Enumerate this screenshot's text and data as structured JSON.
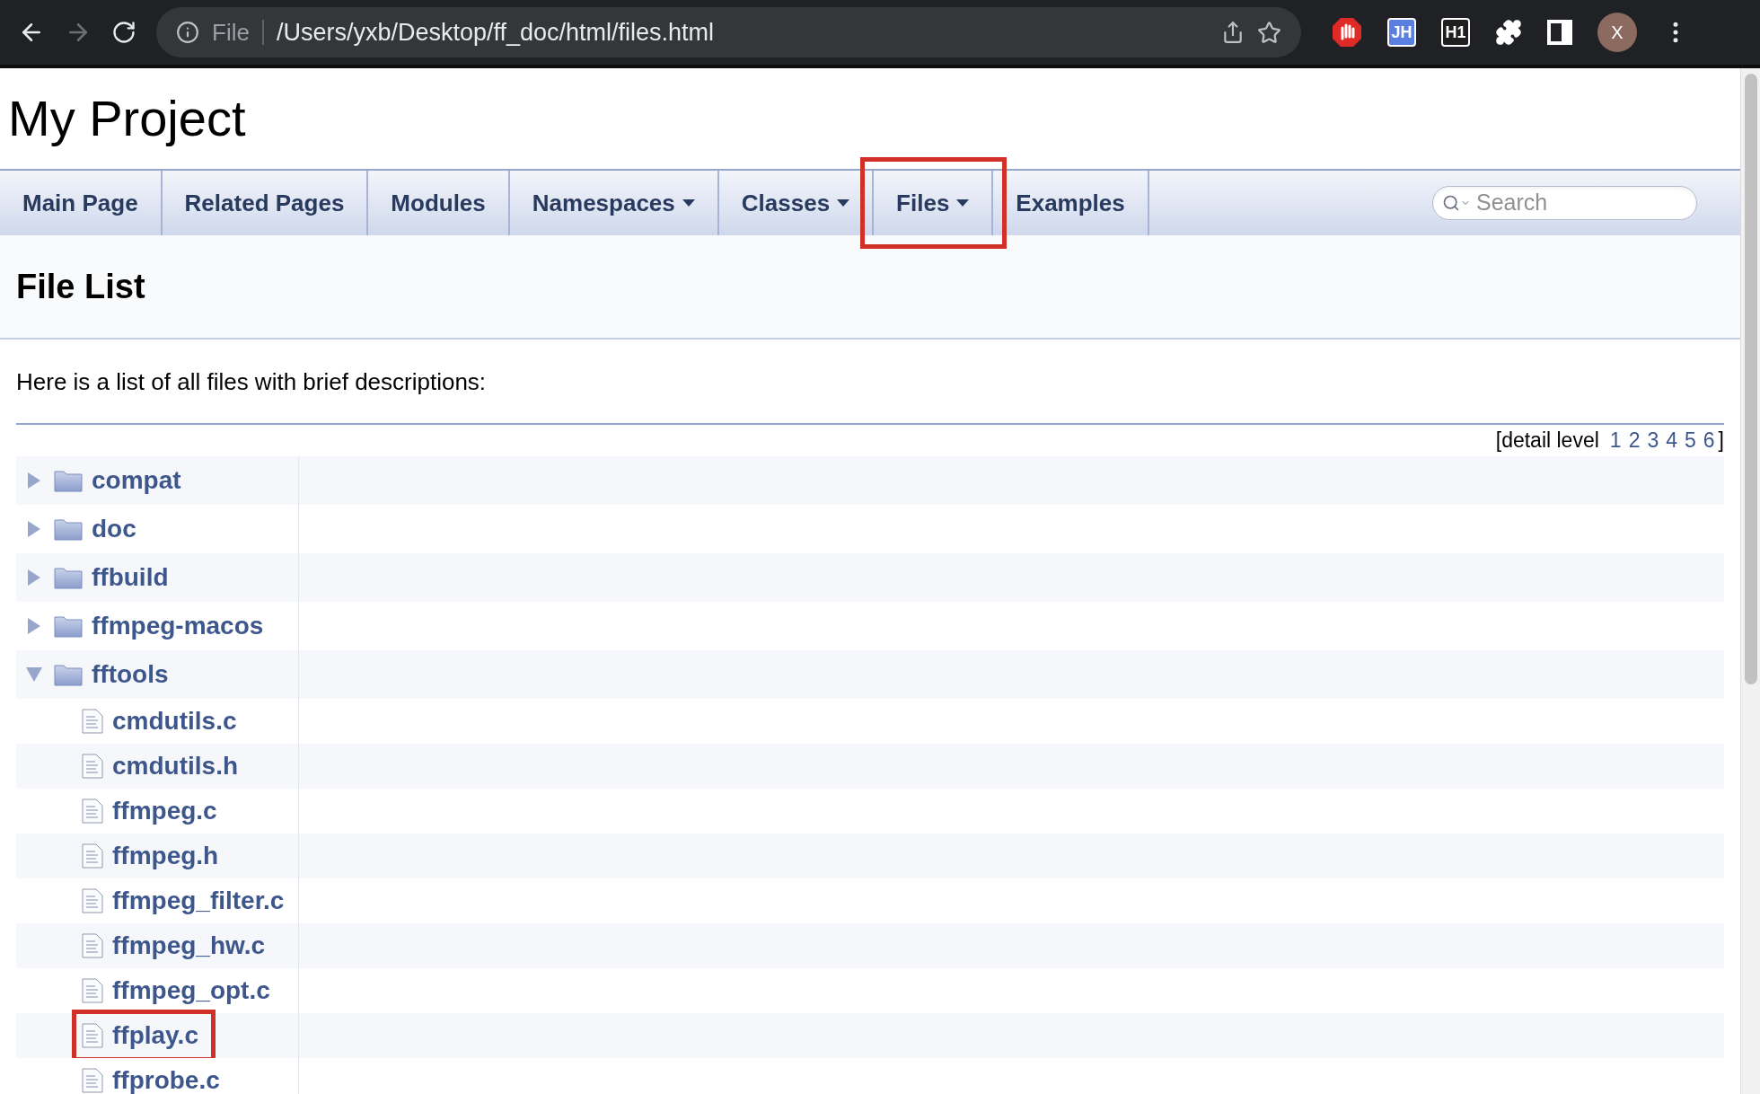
{
  "browser": {
    "back_enabled": true,
    "forward_enabled": false,
    "scheme": "File",
    "url": "/Users/yxb/Desktop/ff_doc/html/files.html",
    "extensions": [
      {
        "kind": "stop"
      },
      {
        "kind": "badge",
        "label": "JH",
        "color": "#5b7fe0"
      },
      {
        "kind": "badge",
        "label": "H1",
        "color": "#1f1f1f"
      },
      {
        "kind": "puzzle"
      },
      {
        "kind": "sidebar"
      }
    ],
    "avatar": "X"
  },
  "project_title": "My Project",
  "nav": {
    "items": [
      {
        "label": "Main Page",
        "dropdown": false,
        "highlighted": false
      },
      {
        "label": "Related Pages",
        "dropdown": false,
        "highlighted": false
      },
      {
        "label": "Modules",
        "dropdown": false,
        "highlighted": false
      },
      {
        "label": "Namespaces",
        "dropdown": true,
        "highlighted": false
      },
      {
        "label": "Classes",
        "dropdown": true,
        "highlighted": false
      },
      {
        "label": "Files",
        "dropdown": true,
        "highlighted": true
      },
      {
        "label": "Examples",
        "dropdown": false,
        "highlighted": false
      }
    ],
    "search": {
      "placeholder": "Search"
    }
  },
  "page_title": "File List",
  "description": "Here is a list of all files with brief descriptions:",
  "detail_level": {
    "label": "[detail level",
    "levels": [
      "1",
      "2",
      "3",
      "4",
      "5",
      "6"
    ],
    "closing": "]"
  },
  "tree": [
    {
      "kind": "folder",
      "name": "compat",
      "expanded": false,
      "highlighted": false
    },
    {
      "kind": "folder",
      "name": "doc",
      "expanded": false,
      "highlighted": false
    },
    {
      "kind": "folder",
      "name": "ffbuild",
      "expanded": false,
      "highlighted": false
    },
    {
      "kind": "folder",
      "name": "ffmpeg-macos",
      "expanded": false,
      "highlighted": false
    },
    {
      "kind": "folder",
      "name": "fftools",
      "expanded": true,
      "highlighted": false,
      "children": [
        {
          "kind": "file",
          "name": "cmdutils.c",
          "highlighted": false
        },
        {
          "kind": "file",
          "name": "cmdutils.h",
          "highlighted": false
        },
        {
          "kind": "file",
          "name": "ffmpeg.c",
          "highlighted": false
        },
        {
          "kind": "file",
          "name": "ffmpeg.h",
          "highlighted": false
        },
        {
          "kind": "file",
          "name": "ffmpeg_filter.c",
          "highlighted": false
        },
        {
          "kind": "file",
          "name": "ffmpeg_hw.c",
          "highlighted": false
        },
        {
          "kind": "file",
          "name": "ffmpeg_opt.c",
          "highlighted": false
        },
        {
          "kind": "file",
          "name": "ffplay.c",
          "highlighted": true
        },
        {
          "kind": "file",
          "name": "ffprobe.c",
          "highlighted": false
        }
      ]
    }
  ]
}
